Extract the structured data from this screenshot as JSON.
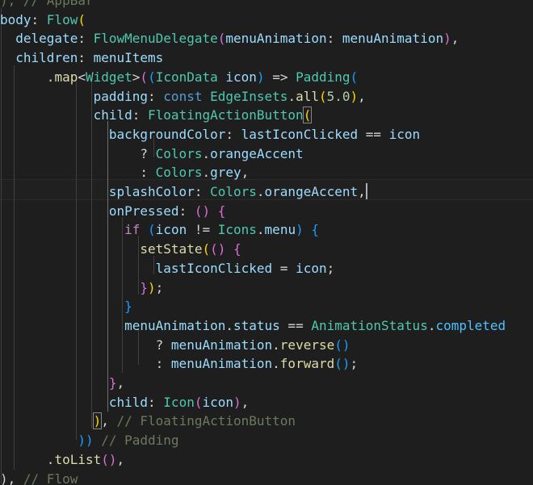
{
  "lines": [
    [
      {
        "t": "), // AppBar",
        "c": "t-fade"
      }
    ],
    [
      {
        "t": "body",
        "c": "t-prop"
      },
      {
        "t": ": ",
        "c": "t-def"
      },
      {
        "t": "Flow",
        "c": "t-type"
      },
      {
        "t": "(",
        "c": "t-b1"
      }
    ],
    [
      {
        "t": "  ",
        "c": "t-def"
      },
      {
        "t": "delegate",
        "c": "t-prop"
      },
      {
        "t": ": ",
        "c": "t-def"
      },
      {
        "t": "FlowMenuDelegate",
        "c": "t-type"
      },
      {
        "t": "(",
        "c": "t-b2"
      },
      {
        "t": "menuAnimation",
        "c": "t-prop"
      },
      {
        "t": ": ",
        "c": "t-def"
      },
      {
        "t": "menuAnimation",
        "c": "t-prop"
      },
      {
        "t": ")",
        "c": "t-b2"
      },
      {
        "t": ",",
        "c": "t-def"
      }
    ],
    [
      {
        "t": "  ",
        "c": "t-def"
      },
      {
        "t": "children",
        "c": "t-prop"
      },
      {
        "t": ": ",
        "c": "t-def"
      },
      {
        "t": "menuItems",
        "c": "t-prop"
      }
    ],
    [
      {
        "t": "      .",
        "c": "t-def"
      },
      {
        "t": "map",
        "c": "t-fn"
      },
      {
        "t": "<",
        "c": "t-def"
      },
      {
        "t": "Widget",
        "c": "t-type"
      },
      {
        "t": ">",
        "c": "t-def"
      },
      {
        "t": "(",
        "c": "t-b2"
      },
      {
        "t": "(",
        "c": "t-b3"
      },
      {
        "t": "IconData",
        "c": "t-type"
      },
      {
        "t": " icon",
        "c": "t-prop"
      },
      {
        "t": ")",
        "c": "t-b3"
      },
      {
        "t": " => ",
        "c": "t-def"
      },
      {
        "t": "Padding",
        "c": "t-type"
      },
      {
        "t": "(",
        "c": "t-b3"
      }
    ],
    [
      {
        "t": "            ",
        "c": "t-def"
      },
      {
        "t": "padding",
        "c": "t-prop"
      },
      {
        "t": ": ",
        "c": "t-def"
      },
      {
        "t": "const",
        "c": "t-kw"
      },
      {
        "t": " ",
        "c": "t-def"
      },
      {
        "t": "EdgeInsets",
        "c": "t-type"
      },
      {
        "t": ".",
        "c": "t-def"
      },
      {
        "t": "all",
        "c": "t-fn"
      },
      {
        "t": "(",
        "c": "t-b1"
      },
      {
        "t": "5.0",
        "c": "t-num"
      },
      {
        "t": ")",
        "c": "t-b1"
      },
      {
        "t": ",",
        "c": "t-def"
      }
    ],
    [
      {
        "t": "            ",
        "c": "t-def"
      },
      {
        "t": "child",
        "c": "t-prop"
      },
      {
        "t": ": ",
        "c": "t-def"
      },
      {
        "t": "FloatingActionButton",
        "c": "t-type"
      },
      {
        "t": "(",
        "c": "t-b1 hl-bracket"
      }
    ],
    [
      {
        "t": "              ",
        "c": "t-def"
      },
      {
        "t": "backgroundColor",
        "c": "t-prop"
      },
      {
        "t": ": ",
        "c": "t-def"
      },
      {
        "t": "lastIconClicked",
        "c": "t-prop"
      },
      {
        "t": " == ",
        "c": "t-def"
      },
      {
        "t": "icon",
        "c": "t-prop"
      }
    ],
    [
      {
        "t": "                  ? ",
        "c": "t-def"
      },
      {
        "t": "Colors",
        "c": "t-type"
      },
      {
        "t": ".",
        "c": "t-def"
      },
      {
        "t": "orangeAccent",
        "c": "t-prop"
      }
    ],
    [
      {
        "t": "                  : ",
        "c": "t-def"
      },
      {
        "t": "Colors",
        "c": "t-type"
      },
      {
        "t": ".",
        "c": "t-def"
      },
      {
        "t": "grey",
        "c": "t-prop"
      },
      {
        "t": ",",
        "c": "t-def"
      }
    ],
    [
      {
        "t": "              ",
        "c": "t-def"
      },
      {
        "t": "splashColor",
        "c": "t-prop"
      },
      {
        "t": ": ",
        "c": "t-def"
      },
      {
        "t": "Colors",
        "c": "t-type"
      },
      {
        "t": ".",
        "c": "t-def"
      },
      {
        "t": "orangeAccent",
        "c": "t-prop"
      },
      {
        "t": ",",
        "c": "t-def"
      },
      {
        "t": "",
        "c": "cursor"
      }
    ],
    [
      {
        "t": "              ",
        "c": "t-def"
      },
      {
        "t": "onPressed",
        "c": "t-prop"
      },
      {
        "t": ": ",
        "c": "t-def"
      },
      {
        "t": "()",
        "c": "t-b2"
      },
      {
        "t": " ",
        "c": "t-def"
      },
      {
        "t": "{",
        "c": "t-b2"
      }
    ],
    [
      {
        "t": "                ",
        "c": "t-def"
      },
      {
        "t": "if",
        "c": "t-ctl"
      },
      {
        "t": " ",
        "c": "t-def"
      },
      {
        "t": "(",
        "c": "t-b3"
      },
      {
        "t": "icon",
        "c": "t-prop"
      },
      {
        "t": " != ",
        "c": "t-def"
      },
      {
        "t": "Icons",
        "c": "t-type"
      },
      {
        "t": ".",
        "c": "t-def"
      },
      {
        "t": "menu",
        "c": "t-prop"
      },
      {
        "t": ")",
        "c": "t-b3"
      },
      {
        "t": " ",
        "c": "t-def"
      },
      {
        "t": "{",
        "c": "t-b3"
      }
    ],
    [
      {
        "t": "                  ",
        "c": "t-def"
      },
      {
        "t": "setState",
        "c": "t-fn"
      },
      {
        "t": "(",
        "c": "t-b1"
      },
      {
        "t": "()",
        "c": "t-b2"
      },
      {
        "t": " ",
        "c": "t-def"
      },
      {
        "t": "{",
        "c": "t-b2"
      }
    ],
    [
      {
        "t": "                    ",
        "c": "t-def"
      },
      {
        "t": "lastIconClicked",
        "c": "t-prop"
      },
      {
        "t": " = ",
        "c": "t-def"
      },
      {
        "t": "icon",
        "c": "t-prop"
      },
      {
        "t": ";",
        "c": "t-def"
      }
    ],
    [
      {
        "t": "                  ",
        "c": "t-def"
      },
      {
        "t": "}",
        "c": "t-b2"
      },
      {
        "t": ")",
        "c": "t-b1"
      },
      {
        "t": ";",
        "c": "t-def"
      }
    ],
    [
      {
        "t": "                ",
        "c": "t-def"
      },
      {
        "t": "}",
        "c": "t-b3"
      }
    ],
    [
      {
        "t": "                ",
        "c": "t-def"
      },
      {
        "t": "menuAnimation",
        "c": "t-prop"
      },
      {
        "t": ".",
        "c": "t-def"
      },
      {
        "t": "status",
        "c": "t-prop"
      },
      {
        "t": " == ",
        "c": "t-def"
      },
      {
        "t": "AnimationStatus",
        "c": "t-type"
      },
      {
        "t": ".",
        "c": "t-def"
      },
      {
        "t": "completed",
        "c": "t-enum"
      }
    ],
    [
      {
        "t": "                    ? ",
        "c": "t-def"
      },
      {
        "t": "menuAnimation",
        "c": "t-prop"
      },
      {
        "t": ".",
        "c": "t-def"
      },
      {
        "t": "reverse",
        "c": "t-fn"
      },
      {
        "t": "()",
        "c": "t-b3"
      }
    ],
    [
      {
        "t": "                    : ",
        "c": "t-def"
      },
      {
        "t": "menuAnimation",
        "c": "t-prop"
      },
      {
        "t": ".",
        "c": "t-def"
      },
      {
        "t": "forward",
        "c": "t-fn"
      },
      {
        "t": "()",
        "c": "t-b3"
      },
      {
        "t": ";",
        "c": "t-def"
      }
    ],
    [
      {
        "t": "              ",
        "c": "t-def"
      },
      {
        "t": "}",
        "c": "t-b2"
      },
      {
        "t": ",",
        "c": "t-def"
      }
    ],
    [
      {
        "t": "              ",
        "c": "t-def"
      },
      {
        "t": "child",
        "c": "t-prop"
      },
      {
        "t": ": ",
        "c": "t-def"
      },
      {
        "t": "Icon",
        "c": "t-type"
      },
      {
        "t": "(",
        "c": "t-b2"
      },
      {
        "t": "icon",
        "c": "t-prop"
      },
      {
        "t": ")",
        "c": "t-b2"
      },
      {
        "t": ",",
        "c": "t-def"
      }
    ],
    [
      {
        "t": "            ",
        "c": "t-def"
      },
      {
        "t": ")",
        "c": "t-b1 hl-bracket"
      },
      {
        "t": ", ",
        "c": "t-def"
      },
      {
        "t": "// FloatingActionButton",
        "c": "t-fade"
      }
    ],
    [
      {
        "t": "          ",
        "c": "t-def"
      },
      {
        "t": "))",
        "c": "t-b3"
      },
      {
        "t": " ",
        "c": "t-def"
      },
      {
        "t": "// Padding",
        "c": "t-fade"
      }
    ],
    [
      {
        "t": "      .",
        "c": "t-def"
      },
      {
        "t": "toList",
        "c": "t-fn"
      },
      {
        "t": "()",
        "c": "t-b2"
      },
      {
        "t": ",",
        "c": "t-def"
      }
    ],
    [
      {
        "t": "), ",
        "c": "t-def"
      },
      {
        "t": "// Flow",
        "c": "t-fade"
      }
    ]
  ]
}
